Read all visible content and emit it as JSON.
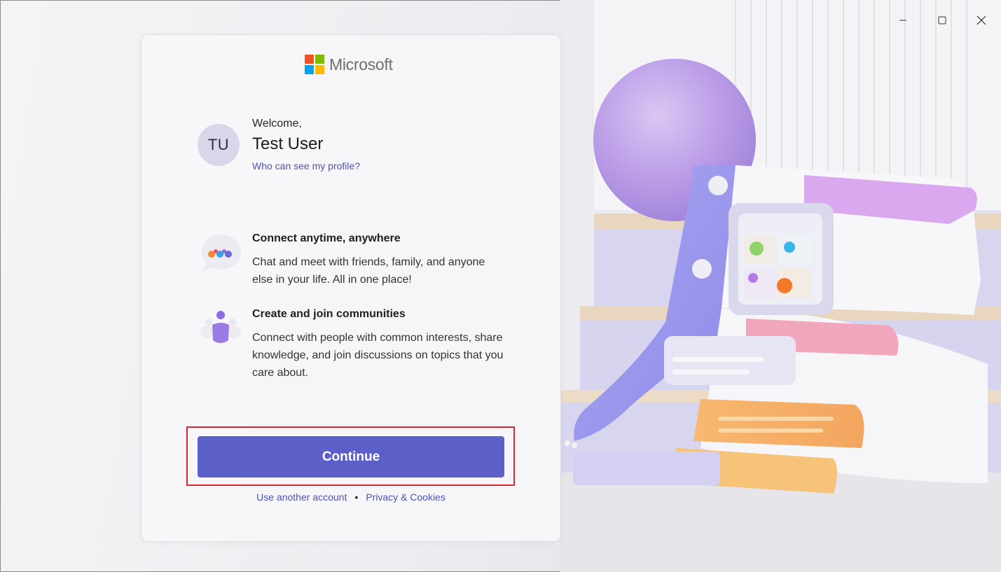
{
  "brand": {
    "name": "Microsoft",
    "logo_colors": [
      "#f25022",
      "#7fba00",
      "#00a4ef",
      "#ffb900"
    ]
  },
  "window_controls": {
    "minimize": "minimize-icon",
    "maximize": "maximize-icon",
    "close": "close-icon"
  },
  "profile": {
    "initials": "TU",
    "greeting": "Welcome,",
    "name": "Test User",
    "visibility_link": "Who can see my profile?"
  },
  "features": [
    {
      "icon": "chat-bubble-icon",
      "title": "Connect anytime, anywhere",
      "description": "Chat and meet with friends, family, and anyone else in your life. All in one place!"
    },
    {
      "icon": "community-people-icon",
      "title": "Create and join communities",
      "description": "Connect with people with common interests, share knowledge, and join discussions on topics that you care about."
    }
  ],
  "actions": {
    "continue_label": "Continue",
    "another_account": "Use another account",
    "separator": "•",
    "privacy": "Privacy & Cookies"
  },
  "colors": {
    "accent": "#5b5fc7",
    "link": "#4f52b2",
    "highlight": "#d9272e"
  }
}
